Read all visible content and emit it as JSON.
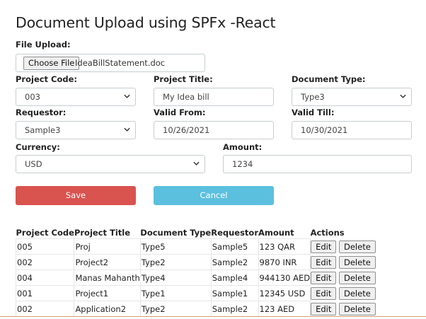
{
  "page": {
    "title": "Document Upload using SPFx -React"
  },
  "file_upload": {
    "label": "File Upload:",
    "button_label": "Choose File",
    "file_name": "IdeaBillStatement.doc"
  },
  "form": {
    "project_code": {
      "label": "Project Code:",
      "value": "003"
    },
    "project_title": {
      "label": "Project Title:",
      "value": "My Idea bill"
    },
    "document_type": {
      "label": "Document Type:",
      "value": "Type3"
    },
    "requestor": {
      "label": "Requestor:",
      "value": "Sample3"
    },
    "valid_from": {
      "label": "Valid From:",
      "value": "10/26/2021"
    },
    "valid_till": {
      "label": "Valid Till:",
      "value": "10/30/2021"
    },
    "currency": {
      "label": "Currency:",
      "value": "USD"
    },
    "amount": {
      "label": "Amount:",
      "value": "1234"
    }
  },
  "actions": {
    "save_label": "Save",
    "cancel_label": "Cancel"
  },
  "table": {
    "headers": [
      "Project Code",
      "Project Title",
      "Document Type",
      "Requestor",
      "Amount",
      "Actions"
    ],
    "edit_label": "Edit",
    "delete_label": "Delete",
    "rows": [
      {
        "code": "005",
        "title": "Proj",
        "doc_type": "Type5",
        "requestor": "Sample5",
        "amount": "123 QAR"
      },
      {
        "code": "002",
        "title": "Project2",
        "doc_type": "Type2",
        "requestor": "Sample2",
        "amount": "9870 INR"
      },
      {
        "code": "004",
        "title": "Manas Mahanth",
        "doc_type": "Type4",
        "requestor": "Sample4",
        "amount": "944130 AED"
      },
      {
        "code": "001",
        "title": "Project1",
        "doc_type": "Type1",
        "requestor": "Sample1",
        "amount": "12345 USD"
      },
      {
        "code": "002",
        "title": "Application2",
        "doc_type": "Type2",
        "requestor": "Sample2",
        "amount": "123 AED"
      }
    ]
  },
  "colors": {
    "save": "#d9534f",
    "cancel": "#5bc0de"
  },
  "icons": {
    "select_arrow": "chevron-down-icon"
  }
}
